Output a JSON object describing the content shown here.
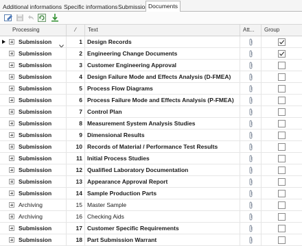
{
  "tabs": [
    {
      "label": "Additional informations"
    },
    {
      "label": "Specific informations"
    },
    {
      "label": "Submission"
    },
    {
      "label": "Documents"
    }
  ],
  "toolbar": {
    "icons": [
      "edit-icon",
      "save-icon",
      "undo-icon",
      "refresh-icon",
      "download-icon"
    ]
  },
  "columns": {
    "processing": "Processing",
    "sort": "⁄",
    "text": "Text",
    "attachment": "Att...",
    "group": "Group"
  },
  "rows": [
    {
      "processing": "Submission",
      "num": "1",
      "text": "Design Records",
      "checked": true,
      "bold": true,
      "current": true
    },
    {
      "processing": "Submission",
      "num": "2",
      "text": "Engineering Change Documents",
      "checked": true,
      "bold": true
    },
    {
      "processing": "Submission",
      "num": "3",
      "text": "Customer Engineering Approval",
      "checked": false,
      "bold": true
    },
    {
      "processing": "Submission",
      "num": "4",
      "text": "Design Failure Mode and Effects Analysis (D-FMEA)",
      "checked": false,
      "bold": true
    },
    {
      "processing": "Submission",
      "num": "5",
      "text": "Process Flow Diagrams",
      "checked": false,
      "bold": true
    },
    {
      "processing": "Submission",
      "num": "6",
      "text": "Process Failure Mode and Effects Analysis (P-FMEA)",
      "checked": false,
      "bold": true
    },
    {
      "processing": "Submission",
      "num": "7",
      "text": "Control Plan",
      "checked": false,
      "bold": true
    },
    {
      "processing": "Submission",
      "num": "8",
      "text": "Measurement System Analysis Studies",
      "checked": false,
      "bold": true
    },
    {
      "processing": "Submission",
      "num": "9",
      "text": "Dimensional Results",
      "checked": false,
      "bold": true
    },
    {
      "processing": "Submission",
      "num": "10",
      "text": "Records of Material / Performance Test Results",
      "checked": false,
      "bold": true
    },
    {
      "processing": "Submission",
      "num": "11",
      "text": "Initial Process Studies",
      "checked": false,
      "bold": true
    },
    {
      "processing": "Submission",
      "num": "12",
      "text": "Qualified Laboratory Documentation",
      "checked": false,
      "bold": true
    },
    {
      "processing": "Submission",
      "num": "13",
      "text": "Appearance Approval Report",
      "checked": false,
      "bold": true
    },
    {
      "processing": "Submission",
      "num": "14",
      "text": "Sample Production Parts",
      "checked": false,
      "bold": true
    },
    {
      "processing": "Archiving",
      "num": "15",
      "text": "Master Sample",
      "checked": false,
      "bold": false
    },
    {
      "processing": "Archiving",
      "num": "16",
      "text": "Checking Aids",
      "checked": false,
      "bold": false
    },
    {
      "processing": "Submission",
      "num": "17",
      "text": "Customer Specific Requirements",
      "checked": false,
      "bold": true
    },
    {
      "processing": "Submission",
      "num": "18",
      "text": "Part Submission Warrant",
      "checked": false,
      "bold": true
    }
  ]
}
